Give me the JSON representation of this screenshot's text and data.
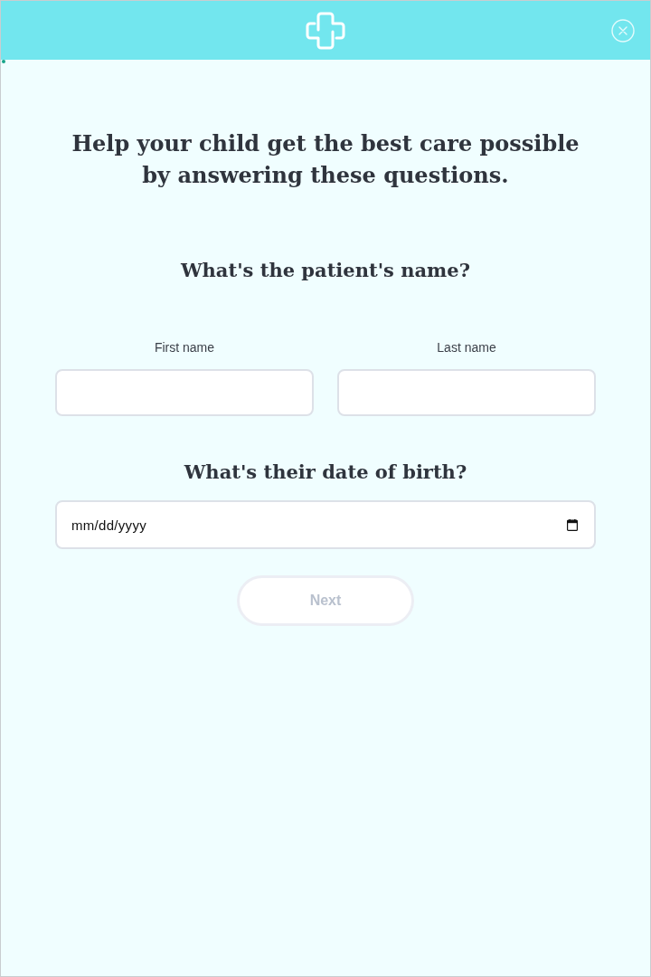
{
  "progress": {
    "level": 0.005
  },
  "title": "Help your child get the best care possible by answering these questions.",
  "sections": [
    {
      "kind": "name",
      "question": "What's the patient's name?",
      "fields": [
        {
          "label": "First name"
        },
        {
          "label": "Last name"
        }
      ]
    },
    {
      "kind": "date",
      "question": "What's their date of birth?",
      "field": {
        "placeholder": "mm/dd/yyyy"
      }
    }
  ],
  "next_button": {
    "label": "Next",
    "disabled": true
  }
}
